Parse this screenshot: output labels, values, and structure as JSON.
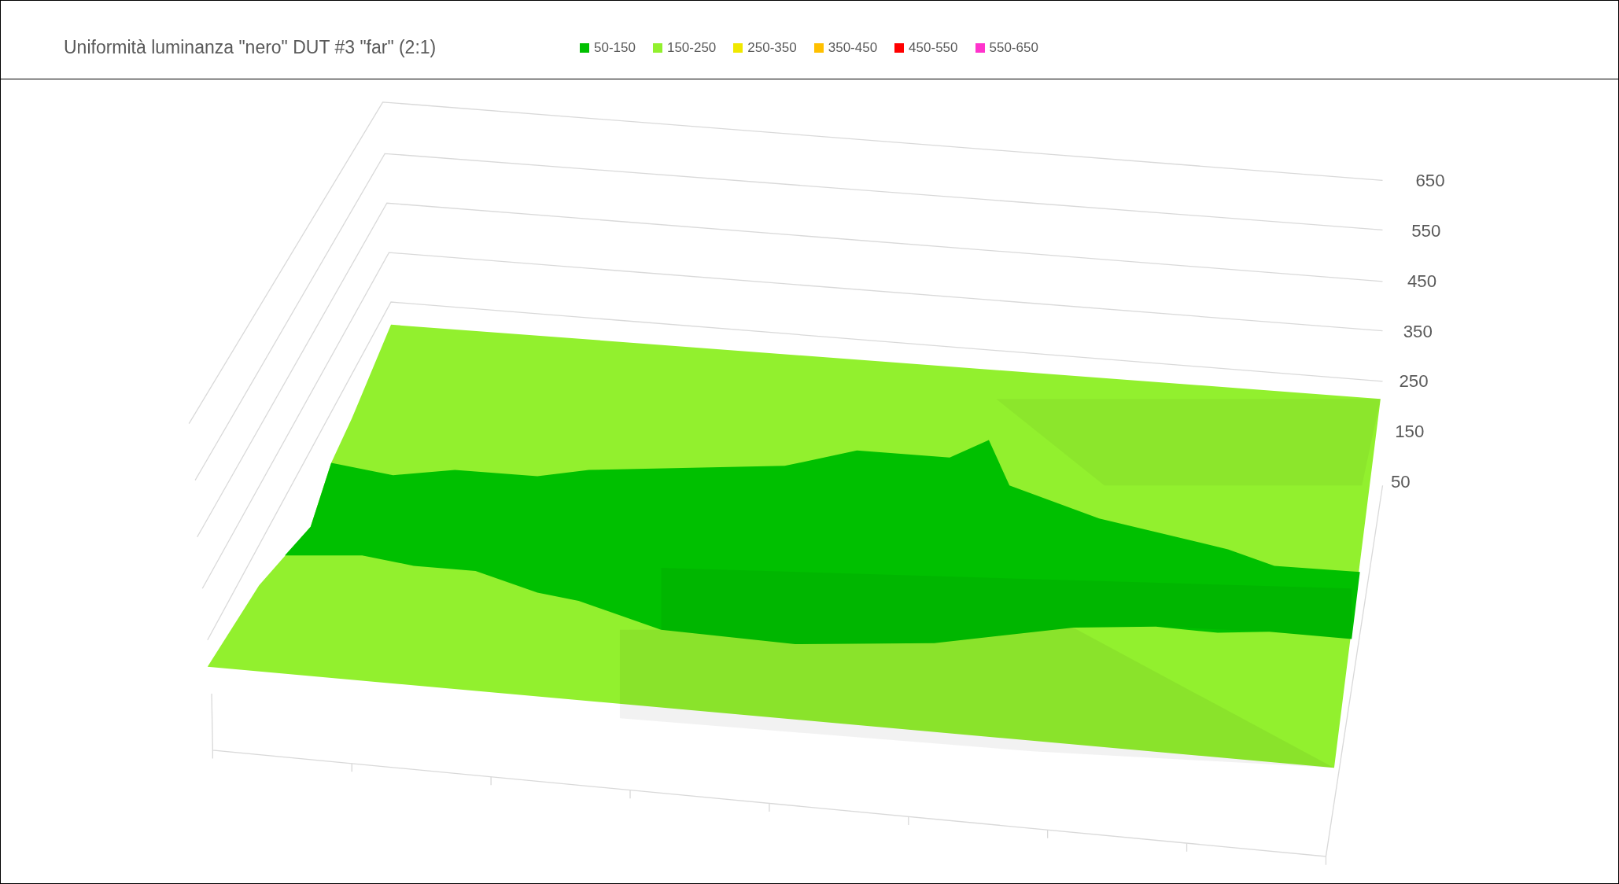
{
  "chart": {
    "title": "Uniformità luminanza \"nero\" DUT #3 \"far\" (2:1)",
    "legend": [
      {
        "label": "50-150",
        "color": "#00c000"
      },
      {
        "label": "150-250",
        "color": "#92f02e"
      },
      {
        "label": "250-350",
        "color": "#f0e800"
      },
      {
        "label": "350-450",
        "color": "#ffc000"
      },
      {
        "label": "450-550",
        "color": "#ff0000"
      },
      {
        "label": "550-650",
        "color": "#ff33cc"
      }
    ],
    "z_axis_labels": [
      "650",
      "550",
      "450",
      "350",
      "250",
      "150",
      "50"
    ]
  }
}
